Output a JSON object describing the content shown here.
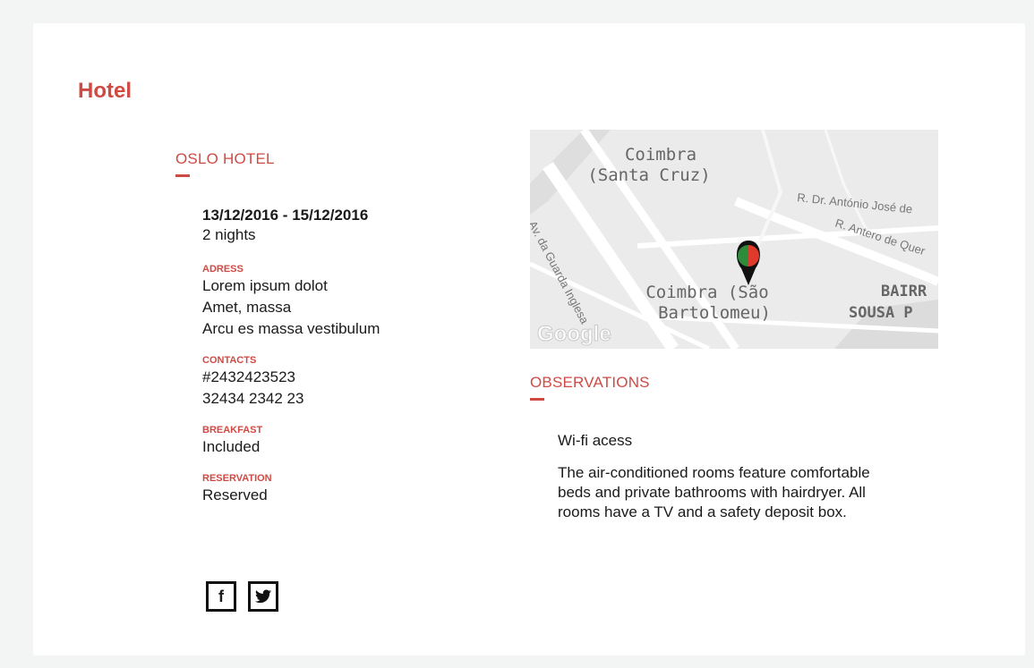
{
  "section": {
    "title": "Hotel"
  },
  "hotel": {
    "name": "OSLO HOTEL",
    "dates": "13/12/2016 - 15/12/2016",
    "nights": "2 nights",
    "address": {
      "label": "ADRESS",
      "lines": [
        "Lorem ipsum dolot",
        "Amet, massa",
        "Arcu es massa vestibulum"
      ]
    },
    "contacts": {
      "label": "CONTACTS",
      "lines": [
        "#2432423523",
        "32434 2342 23"
      ]
    },
    "breakfast": {
      "label": "BREAKFAST",
      "value": "Included"
    },
    "reservation": {
      "label": "RESERVATION",
      "value": "Reserved"
    }
  },
  "social": {
    "facebook_glyph": "f",
    "icons": [
      "facebook-icon",
      "twitter-icon"
    ]
  },
  "map": {
    "labels": {
      "santa_cruz_1": "Coimbra",
      "santa_cruz_2": "(Santa Cruz)",
      "street_antonio": "R. Dr. António José de",
      "street_antero": "R. Antero de Quer",
      "av_guarda": "Av. da Guarda Inglesa",
      "sao_bartolomeu_1": "Coimbra (São",
      "sao_bartolomeu_2": "Bartolomeu)",
      "bairro_1": "BAIRR",
      "bairro_2": "SOUSA P",
      "google": "Google"
    },
    "pin_colors": {
      "left": "#2e8b3a",
      "right": "#e03a2c",
      "body": "#111111"
    }
  },
  "observations": {
    "title": "OBSERVATIONS",
    "items": [
      "Wi-fi acess",
      "The air-conditioned rooms feature comfortable beds and private bathrooms with hairdryer. All rooms have a TV and a safety deposit box."
    ]
  },
  "colors": {
    "accent": "#d04a44",
    "background": "#f3f5f4",
    "card": "#ffffff"
  }
}
